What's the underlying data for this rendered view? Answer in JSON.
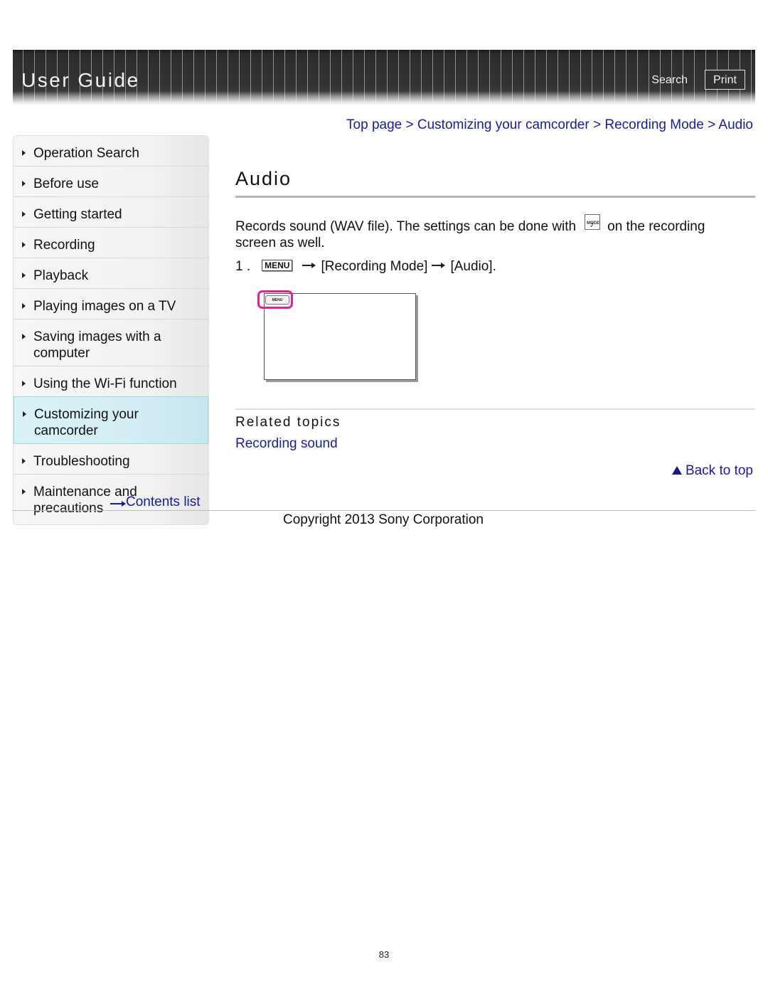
{
  "header": {
    "title": "User Guide",
    "search_label": "Search",
    "print_label": "Print"
  },
  "breadcrumb": {
    "items": [
      "Top page",
      "Customizing your camcorder",
      "Recording Mode",
      "Audio"
    ],
    "separator": ">"
  },
  "sidebar": {
    "items": [
      {
        "label": "Operation Search",
        "active": false
      },
      {
        "label": "Before use",
        "active": false
      },
      {
        "label": "Getting started",
        "active": false
      },
      {
        "label": "Recording",
        "active": false
      },
      {
        "label": "Playback",
        "active": false
      },
      {
        "label": "Playing images on a TV",
        "active": false
      },
      {
        "label": "Saving images with a computer",
        "active": false
      },
      {
        "label": "Using the Wi-Fi function",
        "active": false
      },
      {
        "label": "Customizing your camcorder",
        "active": true
      },
      {
        "label": "Troubleshooting",
        "active": false
      },
      {
        "label": "Maintenance and precautions",
        "active": false
      }
    ],
    "contents_link": "Contents list"
  },
  "main": {
    "title": "Audio",
    "description_before_icon": "Records sound (WAV file). The settings can be done with",
    "mode_icon_label": "MODE",
    "mode_icon_glyph": "♪",
    "description_after_icon": "on the recording screen as well.",
    "step": {
      "number": "1 .",
      "menu_button": "MENU",
      "item1": "[Recording Mode]",
      "item2": "[Audio]."
    },
    "illustration": {
      "menu_label": "MENU",
      "highlight_color": "#e6208c"
    },
    "related": {
      "heading": "Related topics",
      "links": [
        "Recording sound"
      ]
    },
    "back_to_top": "Back to top"
  },
  "footer": {
    "copyright": "Copyright 2013 Sony Corporation",
    "page_number": "83"
  },
  "colors": {
    "link": "#1a1aa6",
    "active_nav": "#d3eef4",
    "header_bg": "#333333"
  }
}
